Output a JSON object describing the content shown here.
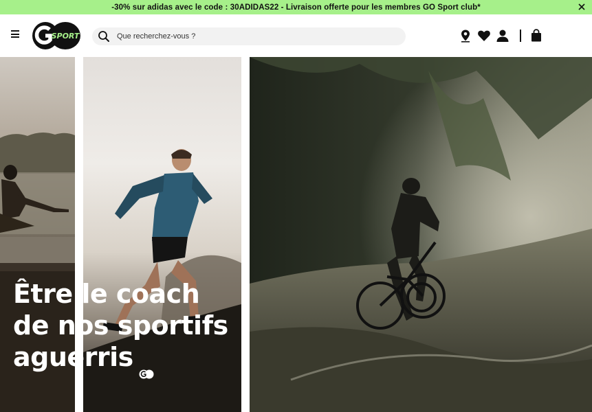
{
  "promo": {
    "text": "-30% sur adidas avec le code : 30ADIDAS22 - Livraison offerte pour les membres GO Sport club*",
    "close_icon": "close-icon",
    "background": "#a6f08a"
  },
  "header": {
    "menu_icon": "hamburger-menu-icon",
    "logo_text_go": "GO",
    "logo_text_sport": "SPORT",
    "search": {
      "placeholder": "Que recherchez-vous ?",
      "icon": "search-icon"
    },
    "icons": [
      "location-pin-icon",
      "heart-icon",
      "user-icon",
      "shopping-bag-icon"
    ]
  },
  "hero": {
    "title_line1": "Être le coach",
    "title_line2": "de nos sportifs",
    "title_line3": "aguerris",
    "badge_text": "GO"
  },
  "colors": {
    "brand_green": "#a6f08a",
    "text_dark": "#111111"
  }
}
